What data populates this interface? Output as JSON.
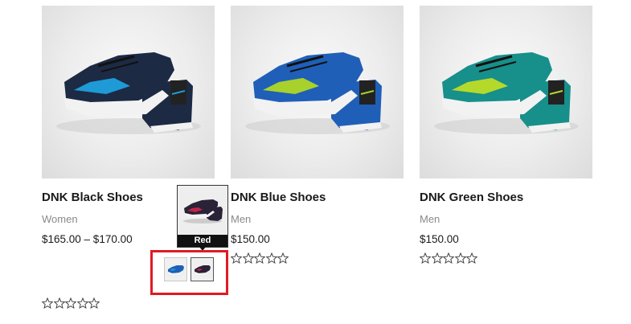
{
  "products": [
    {
      "title": "DNK Black Shoes",
      "category": "Women",
      "price": "$165.00 – $170.00",
      "rating": 0,
      "colors": {
        "body": "#1c2a44",
        "accent": "#1e9ad6",
        "sole": "#f2f2f2",
        "lace": "#111111"
      }
    },
    {
      "title": "DNK Blue Shoes",
      "category": "Men",
      "price": "$150.00",
      "rating": 0,
      "colors": {
        "body": "#1f5fb8",
        "accent": "#a8d22b",
        "sole": "#f2f2f2",
        "lace": "#111111"
      }
    },
    {
      "title": "DNK Green Shoes",
      "category": "Men",
      "price": "$150.00",
      "rating": 0,
      "colors": {
        "body": "#178f8a",
        "accent": "#b5d92b",
        "sole": "#f2f2f2",
        "lace": "#111111"
      }
    }
  ],
  "swatch_tooltip": {
    "label": "Red",
    "icon": "shoe-thumbnail"
  },
  "swatches": [
    {
      "name": "Blue",
      "icon": "shoe-swatch-blue",
      "selected": false
    },
    {
      "name": "Red",
      "icon": "shoe-swatch-red",
      "selected": true
    }
  ],
  "highlight_color": "#e01b24"
}
